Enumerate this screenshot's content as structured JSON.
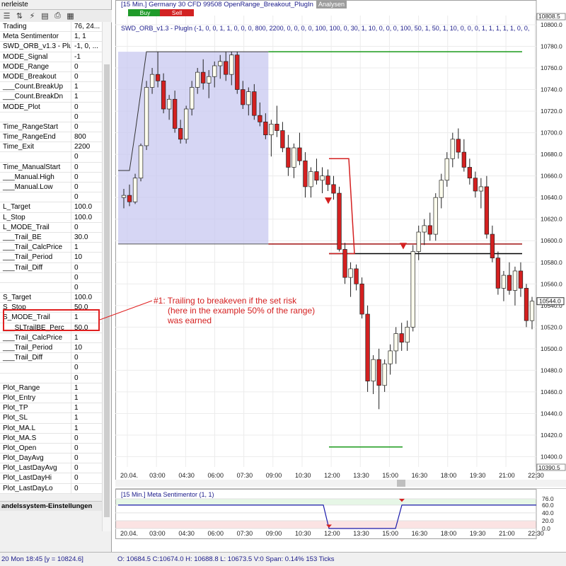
{
  "left_panel": {
    "title": "nerleiste",
    "section_footer": "andelssystem-Einstellungen",
    "properties": [
      {
        "name": "Trading",
        "value": "76, 24..."
      },
      {
        "name": "Meta Sentimentor",
        "value": "1, 1"
      },
      {
        "name": "SWD_ORB_v1.3 - Plu...",
        "value": "-1, 0, ..."
      },
      {
        "name": "MODE_Signal",
        "value": "-1"
      },
      {
        "name": "MODE_Range",
        "value": "0"
      },
      {
        "name": "MODE_Breakout",
        "value": "0"
      },
      {
        "name": "___Count.BreakUp",
        "value": "1"
      },
      {
        "name": "___Count.BreakDn",
        "value": "1"
      },
      {
        "name": "MODE_Plot",
        "value": "0"
      },
      {
        "name": "",
        "value": "0"
      },
      {
        "name": "Time_RangeStart",
        "value": "0"
      },
      {
        "name": "Time_RangeEnd",
        "value": "800"
      },
      {
        "name": "Time_Exit",
        "value": "2200"
      },
      {
        "name": "",
        "value": "0"
      },
      {
        "name": "Time_ManualStart",
        "value": "0"
      },
      {
        "name": "___Manual.High",
        "value": "0"
      },
      {
        "name": "___Manual.Low",
        "value": "0"
      },
      {
        "name": "",
        "value": "0"
      },
      {
        "name": "L_Target",
        "value": "100.0"
      },
      {
        "name": "L_Stop",
        "value": "100.0"
      },
      {
        "name": "L_MODE_Trail",
        "value": "0"
      },
      {
        "name": "___Trail_BE",
        "value": "30.0"
      },
      {
        "name": "___Trail_CalcPrice",
        "value": "1"
      },
      {
        "name": "___Trail_Period",
        "value": "10"
      },
      {
        "name": "___Trail_Diff",
        "value": "0"
      },
      {
        "name": "",
        "value": "0"
      },
      {
        "name": "",
        "value": "0"
      },
      {
        "name": "S_Target",
        "value": "100.0"
      },
      {
        "name": "S_Stop",
        "value": "50.0"
      },
      {
        "name": "S_MODE_Trail",
        "value": "1"
      },
      {
        "name": "___SLTrailBE_Perc",
        "value": "50.0"
      },
      {
        "name": "___Trail_CalcPrice",
        "value": "1"
      },
      {
        "name": "___Trail_Period",
        "value": "10"
      },
      {
        "name": "___Trail_Diff",
        "value": "0"
      },
      {
        "name": "",
        "value": "0"
      },
      {
        "name": "",
        "value": "0"
      },
      {
        "name": "Plot_Range",
        "value": "1"
      },
      {
        "name": "Plot_Entry",
        "value": "1"
      },
      {
        "name": "Plot_TP",
        "value": "1"
      },
      {
        "name": "Plot_SL",
        "value": "1"
      },
      {
        "name": "Plot_MA.L",
        "value": "1"
      },
      {
        "name": "Plot_MA.S",
        "value": "0"
      },
      {
        "name": "Plot_Open",
        "value": "0"
      },
      {
        "name": "Plot_DayAvg",
        "value": "0"
      },
      {
        "name": "Plot_LastDayAvg",
        "value": "0"
      },
      {
        "name": "Plot_LastDayHi",
        "value": "0"
      },
      {
        "name": "Plot_LastDayLo",
        "value": "0"
      }
    ]
  },
  "annotation": {
    "line1": "#1: Trailing to breakeven if the set risk",
    "line2": "(here in the example 50% of the range)",
    "line3": "was earned"
  },
  "chart_header": {
    "title": "[15 Min.] Germany 30 CFD   99508 OpenRange_Breakout_PlugIn",
    "analysen": "Analysen",
    "buy": "Buy",
    "sell": "Sell",
    "indicator": "SWD_ORB_v1.3 - PlugIn  (-1, 0, 0, 1, 1, 0, 0, 0, 800, 2200, 0, 0, 0, 0, 100, 100, 0, 30, 1, 10, 0, 0, 0, 100, 50, 1, 50, 1, 10, 0, 0, 0, 1, 1, 1, 1, 1, 0, 0,"
  },
  "osc_header": "[15 Min.] Meta Sentimentor  (1, 1)",
  "status": {
    "left": "20 Mon  18:45 [y = 10824.6]",
    "right": "O: 10684.5 C:10674.0 H: 10688.8 L: 10673.5 V:0 Span: 0.14% 153 Ticks"
  },
  "chart_data": {
    "type": "candlestick",
    "y_axis_labels": [
      "10800.0",
      "10780.0",
      "10760.0",
      "10740.0",
      "10720.0",
      "10700.0",
      "10680.0",
      "10660.0",
      "10640.0",
      "10620.0",
      "10600.0",
      "10580.0",
      "10560.0",
      "10540.0",
      "10520.0",
      "10500.0",
      "10480.0",
      "10460.0",
      "10440.0",
      "10420.0",
      "10400.0"
    ],
    "y_top_label": "10808.5",
    "y_bottom_label": "10390.5",
    "current_price_label": "10544.0",
    "ylim": [
      10390.5,
      10808.5
    ],
    "x_labels": [
      "20.04.",
      "03:00",
      "04:30",
      "06:00",
      "07:30",
      "09:00",
      "10:30",
      "12:00",
      "13:30",
      "15:00",
      "16:30",
      "18:00",
      "19:30",
      "21:00",
      "22:30"
    ],
    "range_high": 10775,
    "range_low": 10597,
    "colors": {
      "up_candle": "#ffffee",
      "down_candle": "#d42020",
      "range_fill": "#c8c8f0",
      "target_line": "#1a9a1a",
      "stop_line": "#a01010",
      "entry_line": "#000000",
      "indicator_line": "#1a1aaa"
    },
    "candles": [
      [
        10640,
        10648,
        10630,
        10642
      ],
      [
        10642,
        10652,
        10632,
        10636
      ],
      [
        10636,
        10662,
        10634,
        10658
      ],
      [
        10658,
        10690,
        10655,
        10688
      ],
      [
        10688,
        10748,
        10684,
        10742
      ],
      [
        10742,
        10760,
        10736,
        10754
      ],
      [
        10754,
        10775,
        10742,
        10748
      ],
      [
        10748,
        10755,
        10718,
        10722
      ],
      [
        10722,
        10735,
        10712,
        10731
      ],
      [
        10731,
        10739,
        10700,
        10704
      ],
      [
        10704,
        10712,
        10690,
        10694
      ],
      [
        10694,
        10725,
        10690,
        10722
      ],
      [
        10722,
        10748,
        10716,
        10742
      ],
      [
        10742,
        10760,
        10736,
        10756
      ],
      [
        10756,
        10768,
        10740,
        10746
      ],
      [
        10746,
        10758,
        10732,
        10752
      ],
      [
        10752,
        10766,
        10742,
        10762
      ],
      [
        10762,
        10772,
        10750,
        10766
      ],
      [
        10766,
        10775,
        10748,
        10754
      ],
      [
        10754,
        10775,
        10744,
        10772
      ],
      [
        10772,
        10775,
        10736,
        10740
      ],
      [
        10740,
        10748,
        10722,
        10726
      ],
      [
        10726,
        10742,
        10716,
        10738
      ],
      [
        10738,
        10745,
        10712,
        10716
      ],
      [
        10716,
        10728,
        10706,
        10710
      ],
      [
        10710,
        10718,
        10694,
        10698
      ],
      [
        10698,
        10712,
        10678,
        10708
      ],
      [
        10708,
        10725,
        10696,
        10702
      ],
      [
        10702,
        10710,
        10682,
        10686
      ],
      [
        10686,
        10698,
        10660,
        10668
      ],
      [
        10668,
        10690,
        10658,
        10686
      ],
      [
        10686,
        10700,
        10670,
        10674
      ],
      [
        10674,
        10682,
        10640,
        10650
      ],
      [
        10650,
        10668,
        10640,
        10664
      ],
      [
        10664,
        10676,
        10652,
        10656
      ],
      [
        10656,
        10668,
        10644,
        10660
      ],
      [
        10660,
        10666,
        10646,
        10652
      ],
      [
        10652,
        10660,
        10638,
        10644
      ],
      [
        10644,
        10650,
        10590,
        10592
      ],
      [
        10592,
        10598,
        10560,
        10566
      ],
      [
        10566,
        10580,
        10548,
        10574
      ],
      [
        10574,
        10578,
        10554,
        10560
      ],
      [
        10560,
        10566,
        10528,
        10532
      ],
      [
        10532,
        10540,
        10460,
        10470
      ],
      [
        10470,
        10494,
        10458,
        10490
      ],
      [
        10490,
        10500,
        10444,
        10466
      ],
      [
        10466,
        10490,
        10460,
        10486
      ],
      [
        10486,
        10504,
        10476,
        10498
      ],
      [
        10498,
        10520,
        10486,
        10514
      ],
      [
        10514,
        10524,
        10498,
        10506
      ],
      [
        10506,
        10526,
        10498,
        10520
      ],
      [
        10520,
        10596,
        10516,
        10590
      ],
      [
        10590,
        10614,
        10582,
        10608
      ],
      [
        10608,
        10620,
        10596,
        10614
      ],
      [
        10614,
        10626,
        10600,
        10606
      ],
      [
        10606,
        10644,
        10600,
        10640
      ],
      [
        10640,
        10662,
        10630,
        10656
      ],
      [
        10656,
        10682,
        10650,
        10676
      ],
      [
        10676,
        10700,
        10668,
        10694
      ],
      [
        10694,
        10704,
        10676,
        10682
      ],
      [
        10682,
        10694,
        10664,
        10668
      ],
      [
        10668,
        10676,
        10652,
        10658
      ],
      [
        10658,
        10664,
        10640,
        10646
      ],
      [
        10646,
        10658,
        10630,
        10650
      ],
      [
        10650,
        10660,
        10602,
        10606
      ],
      [
        10606,
        10614,
        10580,
        10584
      ],
      [
        10584,
        10590,
        10550,
        10556
      ],
      [
        10556,
        10572,
        10544,
        10568
      ],
      [
        10568,
        10580,
        10550,
        10554
      ],
      [
        10554,
        10576,
        10540,
        10572
      ],
      [
        10572,
        10580,
        10548,
        10556
      ],
      [
        10556,
        10560,
        10520,
        10526
      ],
      [
        10526,
        10548,
        10518,
        10544
      ]
    ]
  },
  "osc_data": {
    "labels": [
      "76.0",
      "60.0",
      "40.0",
      "20.0",
      "0.0"
    ],
    "x_labels": [
      "20.04.",
      "03:00",
      "04:30",
      "06:00",
      "07:30",
      "09:00",
      "10:30",
      "12:00",
      "13:30",
      "15:00",
      "16:30",
      "18:00",
      "19:30",
      "21:00",
      "22:30"
    ]
  }
}
